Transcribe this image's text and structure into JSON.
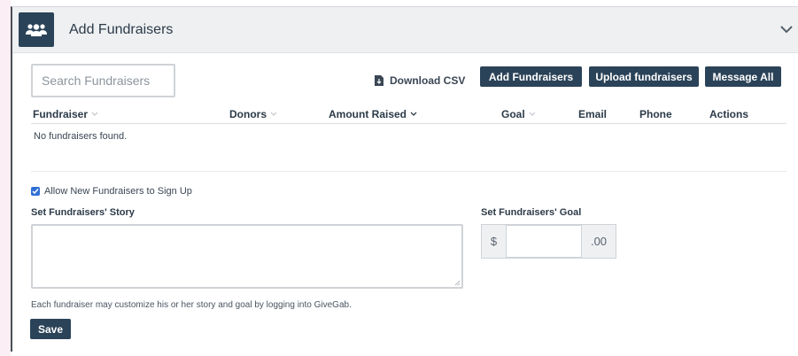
{
  "header": {
    "title": "Add Fundraisers",
    "icon": "group-icon",
    "toggle_icon": "chevron-down-icon"
  },
  "toolbar": {
    "search_placeholder": "Search Fundraisers",
    "download_csv_label": "Download CSV",
    "add_fundraisers_label": "Add Fundraisers",
    "upload_fundraisers_label": "Upload fundraisers",
    "message_all_label": "Message All"
  },
  "table": {
    "columns": [
      {
        "label": "Fundraiser",
        "sortable": true
      },
      {
        "label": "Donors",
        "sortable": true
      },
      {
        "label": "Amount Raised",
        "sortable": true,
        "active": true
      },
      {
        "label": "Goal",
        "sortable": true
      },
      {
        "label": "Email",
        "sortable": false
      },
      {
        "label": "Phone",
        "sortable": false
      },
      {
        "label": "Actions",
        "sortable": false
      }
    ],
    "empty_message": "No fundraisers found."
  },
  "settings": {
    "allow_signup_label": "Allow New Fundraisers to Sign Up",
    "allow_signup_checked": true,
    "story_label": "Set Fundraisers' Story",
    "story_value": "",
    "goal_label": "Set Fundraisers' Goal",
    "goal_prefix": "$",
    "goal_value": "",
    "goal_suffix": ".00",
    "help_text": "Each fundraiser may customize his or her story and goal by logging into GiveGab.",
    "save_label": "Save"
  },
  "colors": {
    "primary": "#2b4358",
    "checkbox": "#2f6fd6",
    "header_bg": "#eef0f2"
  }
}
